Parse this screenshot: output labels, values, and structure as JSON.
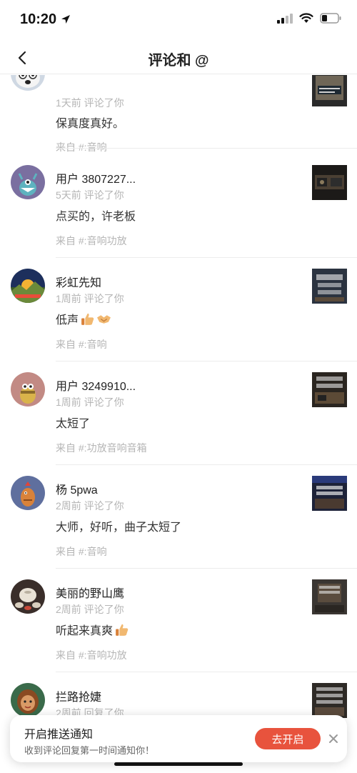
{
  "status_bar": {
    "time": "10:20"
  },
  "nav": {
    "title": "评论和 @"
  },
  "items": [
    {
      "username": "",
      "meta": "1天前 评论了你",
      "comment": "保真度真好。",
      "source": "来自 #:音响"
    },
    {
      "username": "用户 3807227...",
      "meta": "5天前 评论了你",
      "comment": "点买的，许老板",
      "source": "来自 #:音响功放"
    },
    {
      "username": "彩虹先知",
      "meta": "1周前 评论了你",
      "comment": "低声",
      "comment_emojis": [
        "thumbs-up-emoji",
        "handshake-emoji"
      ],
      "source": "来自 #:音响"
    },
    {
      "username": "用户 3249910...",
      "meta": "1周前 评论了你",
      "comment": "太短了",
      "source": "来自 #:功放音响音箱"
    },
    {
      "username": "杨 5pwa",
      "meta": "2周前 评论了你",
      "comment": "大师，好听，曲子太短了",
      "source": "来自 #:音响"
    },
    {
      "username": "美丽的野山鹰",
      "meta": "2周前 评论了你",
      "comment": "听起来真爽",
      "comment_emojis": [
        "thumbs-up-emoji"
      ],
      "source": "来自 #:音响功放"
    },
    {
      "username": "拦路抢婕",
      "meta": "2周前 回复了你",
      "comment": "",
      "source": ""
    }
  ],
  "toast": {
    "title": "开启推送通知",
    "subtitle": "收到评论回复第一时间通知你！",
    "button": "去开启"
  },
  "colors": {
    "accent": "#e8533d",
    "muted_text": "#b5b5b5"
  }
}
